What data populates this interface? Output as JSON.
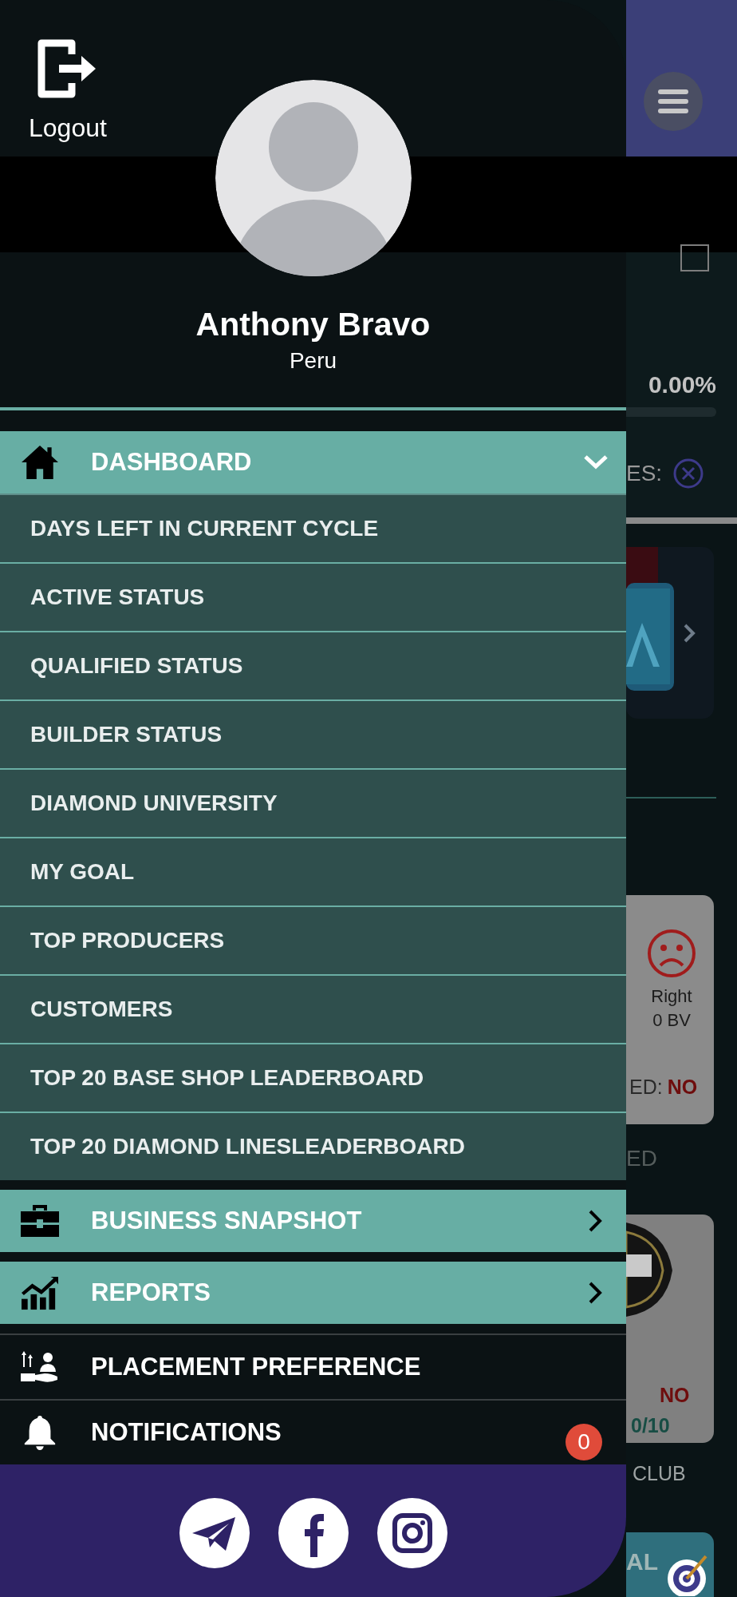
{
  "drawer": {
    "logout_label": "Logout",
    "user": {
      "name": "Anthony Bravo",
      "country": "Peru"
    },
    "menu": [
      {
        "kind": "section",
        "label": "DASHBOARD",
        "expanded": true,
        "children": [
          {
            "label": "DAYS LEFT IN CURRENT CYCLE"
          },
          {
            "label": "ACTIVE STATUS"
          },
          {
            "label": "QUALIFIED STATUS"
          },
          {
            "label": "BUILDER STATUS"
          },
          {
            "label": "DIAMOND UNIVERSITY"
          },
          {
            "label": "MY GOAL"
          },
          {
            "label": "TOP PRODUCERS"
          },
          {
            "label": "CUSTOMERS"
          },
          {
            "label": "TOP 20 BASE SHOP LEADERBOARD"
          },
          {
            "label": "TOP 20 DIAMOND LINESLEADERBOARD"
          }
        ]
      },
      {
        "kind": "section",
        "label": "BUSINESS SNAPSHOT",
        "expanded": false
      },
      {
        "kind": "section",
        "label": "REPORTS",
        "expanded": false
      },
      {
        "kind": "item",
        "label": "PLACEMENT PREFERENCE"
      },
      {
        "kind": "item",
        "label": "NOTIFICATIONS",
        "badge": "0"
      }
    ]
  },
  "background": {
    "checkbox": {
      "checked": false
    },
    "progress": {
      "reading": "0.00%",
      "level": 0
    },
    "filter_fragment": "ES:",
    "status_card": {
      "label": "Right",
      "value": "0 BV",
      "qualified_fragment": "ED:",
      "qualified_value": "NO"
    },
    "caption_fragment": "ED",
    "club_card": {
      "qualified_value": "NO",
      "orders_value": "0/10"
    },
    "club_caption": "CLUB",
    "bottom_fragment": "AL"
  }
}
